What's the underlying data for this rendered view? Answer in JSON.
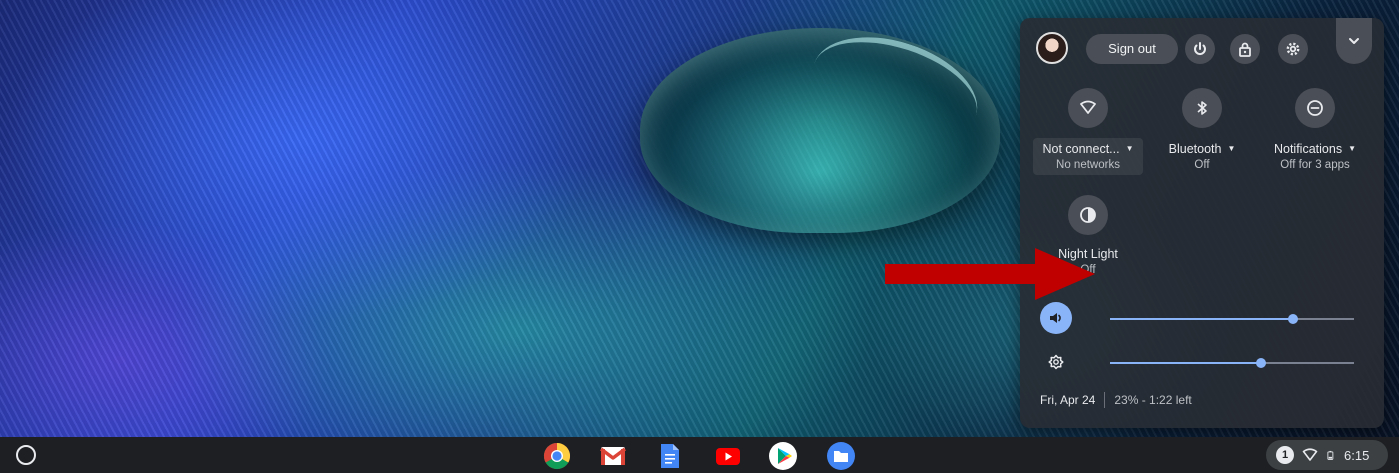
{
  "top_bar": {
    "sign_out_label": "Sign out",
    "icons": [
      "power-icon",
      "lock-icon",
      "gear-icon",
      "chevron-down-icon"
    ]
  },
  "features": [
    {
      "id": "network",
      "label": "Not connect...",
      "sub": "No networks",
      "icon": "wifi-icon"
    },
    {
      "id": "bluetooth",
      "label": "Bluetooth",
      "sub": "Off",
      "icon": "bluetooth-icon"
    },
    {
      "id": "notifications",
      "label": "Notifications",
      "sub": "Off for 3 apps",
      "icon": "do-not-disturb-icon"
    },
    {
      "id": "night_light",
      "label": "Night Light",
      "sub": "Off",
      "icon": "night-light-icon"
    }
  ],
  "sliders": {
    "volume": {
      "value": 0.75,
      "icon": "volume-icon"
    },
    "brightness": {
      "value": 0.62,
      "icon": "brightness-icon"
    }
  },
  "footer": {
    "date": "Fri, Apr 24",
    "battery": "23% - 1:22 left"
  },
  "shelf": {
    "apps": [
      "chrome-icon",
      "gmail-icon",
      "docs-icon",
      "youtube-icon",
      "play-store-icon",
      "files-icon"
    ],
    "tray": {
      "notification_count": "1",
      "time": "6:15"
    }
  },
  "colors": {
    "panel_bg": "#2c3038",
    "accent": "#8ab4f8",
    "annotation_arrow": "#c00000"
  }
}
